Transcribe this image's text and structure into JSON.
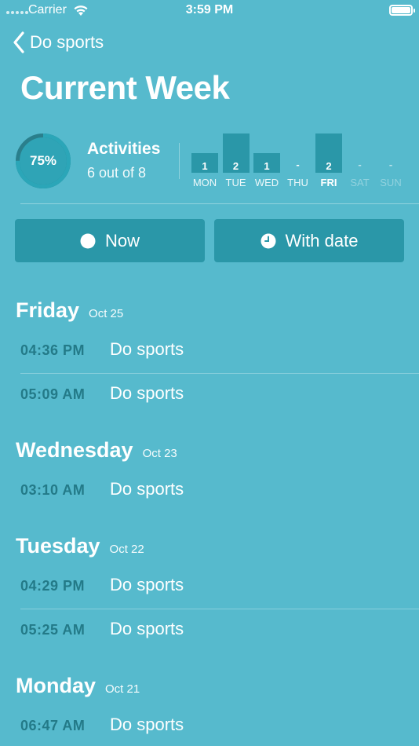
{
  "status_bar": {
    "carrier": "Carrier",
    "time": "3:59 PM"
  },
  "nav": {
    "back_label": "Do sports"
  },
  "page_title": "Current Week",
  "summary": {
    "progress_label": "75%",
    "progress_fraction": 0.75,
    "activities_title": "Activities",
    "activities_count": "6 out of 8"
  },
  "week_chart": {
    "days": [
      {
        "label": "MON",
        "value": "1",
        "count": 1,
        "style": "normal"
      },
      {
        "label": "TUE",
        "value": "2",
        "count": 2,
        "style": "normal"
      },
      {
        "label": "WED",
        "value": "1",
        "count": 1,
        "style": "normal"
      },
      {
        "label": "THU",
        "value": "-",
        "count": 0,
        "style": "normal"
      },
      {
        "label": "FRI",
        "value": "2",
        "count": 2,
        "style": "bold"
      },
      {
        "label": "SAT",
        "value": "-",
        "count": 0,
        "style": "faded"
      },
      {
        "label": "SUN",
        "value": "-",
        "count": 0,
        "style": "faded"
      }
    ],
    "max": 2
  },
  "buttons": {
    "now": "Now",
    "with_date": "With date"
  },
  "sections": [
    {
      "day": "Friday",
      "date": "Oct 25",
      "entries": [
        {
          "time": "04:36 PM",
          "label": "Do sports"
        },
        {
          "time": "05:09 AM",
          "label": "Do sports"
        }
      ]
    },
    {
      "day": "Wednesday",
      "date": "Oct 23",
      "entries": [
        {
          "time": "03:10 AM",
          "label": "Do sports"
        }
      ]
    },
    {
      "day": "Tuesday",
      "date": "Oct 22",
      "entries": [
        {
          "time": "04:29 PM",
          "label": "Do sports"
        },
        {
          "time": "05:25 AM",
          "label": "Do sports"
        }
      ]
    },
    {
      "day": "Monday",
      "date": "Oct 21",
      "entries": [
        {
          "time": "06:47 AM",
          "label": "Do sports"
        }
      ]
    }
  ],
  "colors": {
    "background": "#56bacd",
    "accent": "#2a97a8",
    "time_text": "#237a88"
  }
}
